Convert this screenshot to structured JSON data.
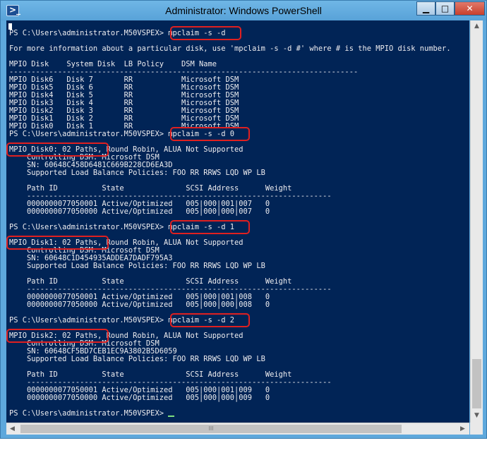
{
  "window": {
    "title": "Administrator: Windows PowerShell",
    "icon": "powershell-icon",
    "buttons": {
      "minimize": "▁",
      "maximize": "□",
      "close": "✕"
    }
  },
  "console": {
    "lines": [
      {
        "text": "PS C:\\Users\\administrator.M50VSPEX> mpclaim -s -d"
      },
      {
        "text": ""
      },
      {
        "text": "For more information about a particular disk, use 'mpclaim -s -d #' where # is the MPIO disk number."
      },
      {
        "text": ""
      },
      {
        "text": "MPIO Disk    System Disk  LB Policy    DSM Name"
      },
      {
        "text": "-------------------------------------------------------------------------------"
      },
      {
        "text": "MPIO Disk6   Disk 7       RR           Microsoft DSM"
      },
      {
        "text": "MPIO Disk5   Disk 6       RR           Microsoft DSM"
      },
      {
        "text": "MPIO Disk4   Disk 5       RR           Microsoft DSM"
      },
      {
        "text": "MPIO Disk3   Disk 4       RR           Microsoft DSM"
      },
      {
        "text": "MPIO Disk2   Disk 3       RR           Microsoft DSM"
      },
      {
        "text": "MPIO Disk1   Disk 2       RR           Microsoft DSM"
      },
      {
        "text": "MPIO Disk0   Disk 1       RR           Microsoft DSM"
      },
      {
        "text": "PS C:\\Users\\administrator.M50VSPEX> mpclaim -s -d 0"
      },
      {
        "text": ""
      },
      {
        "text": "MPIO Disk0: 02 Paths, Round Robin, ALUA Not Supported"
      },
      {
        "text": "    Controlling DSM: Microsoft DSM"
      },
      {
        "text": "    SN: 60648C458D6481C669B228CD6EA3D"
      },
      {
        "text": "    Supported Load Balance Policies: FOO RR RRWS LQD WP LB"
      },
      {
        "text": ""
      },
      {
        "text": "    Path ID          State              SCSI Address      Weight"
      },
      {
        "text": "    ---------------------------------------------------------------------"
      },
      {
        "text": "    0000000077050001 Active/Optimized   005|000|001|007   0"
      },
      {
        "text": "    0000000077050000 Active/Optimized   005|000|000|007   0"
      },
      {
        "text": ""
      },
      {
        "text": "PS C:\\Users\\administrator.M50VSPEX> mpclaim -s -d 1"
      },
      {
        "text": ""
      },
      {
        "text": "MPIO Disk1: 02 Paths, Round Robin, ALUA Not Supported"
      },
      {
        "text": "    Controlling DSM: Microsoft DSM"
      },
      {
        "text": "    SN: 60648C1D454935ADDEA7DADF795A3"
      },
      {
        "text": "    Supported Load Balance Policies: FOO RR RRWS LQD WP LB"
      },
      {
        "text": ""
      },
      {
        "text": "    Path ID          State              SCSI Address      Weight"
      },
      {
        "text": "    ---------------------------------------------------------------------"
      },
      {
        "text": "    0000000077050001 Active/Optimized   005|000|001|008   0"
      },
      {
        "text": "    0000000077050000 Active/Optimized   005|000|000|008   0"
      },
      {
        "text": ""
      },
      {
        "text": "PS C:\\Users\\administrator.M50VSPEX> mpclaim -s -d 2"
      },
      {
        "text": ""
      },
      {
        "text": "MPIO Disk2: 02 Paths, Round Robin, ALUA Not Supported"
      },
      {
        "text": "    Controlling DSM: Microsoft DSM"
      },
      {
        "text": "    SN: 60648CF5BD7CEB1EC9A3802B5D6059"
      },
      {
        "text": "    Supported Load Balance Policies: FOO RR RRWS LQD WP LB"
      },
      {
        "text": ""
      },
      {
        "text": "    Path ID          State              SCSI Address      Weight"
      },
      {
        "text": "    ---------------------------------------------------------------------"
      },
      {
        "text": "    0000000077050001 Active/Optimized   005|000|001|009   0"
      },
      {
        "text": "    0000000077050000 Active/Optimized   005|000|000|009   0"
      },
      {
        "text": ""
      },
      {
        "text": "PS C:\\Users\\administrator.M50VSPEX> "
      }
    ]
  },
  "colors": {
    "console_bg": "#012456",
    "console_text": "#eeedf0",
    "highlight": "#e02020",
    "titlebar": "#5ea8dc"
  },
  "scrollbars": {
    "up_arrow": "▲",
    "down_arrow": "▼",
    "left_arrow": "◀",
    "right_arrow": "▶",
    "grip": "III"
  }
}
